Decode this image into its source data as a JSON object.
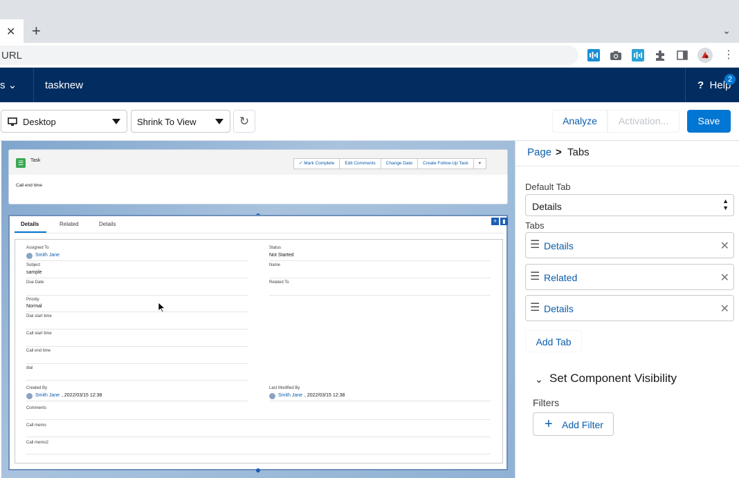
{
  "browser": {
    "tab_close": "✕",
    "new_tab": "+",
    "omnibox_placeholder": "URL",
    "extensions": [
      "audio-ext-icon",
      "camera-icon",
      "audio-ext-icon",
      "puzzle-icon",
      "sidepanel-icon",
      "profile-avatar",
      "kebab-menu-icon"
    ]
  },
  "header": {
    "app_name": "s",
    "page_name": "tasknew",
    "help_label": "Help",
    "help_count": "2"
  },
  "builder_toolbar": {
    "device_label": "Desktop",
    "view_label": "Shrink To View",
    "analyze_label": "Analyze",
    "activation_label": "Activation...",
    "save_label": "Save"
  },
  "canvas": {
    "record_title": "Task",
    "actions": [
      "Mark Complete",
      "Edit Comments",
      "Change Date",
      "Create Follow-Up Task"
    ],
    "highlight_field": "Call end time",
    "tabs": [
      "Details",
      "Related",
      "Details"
    ],
    "fields_left": [
      {
        "label": "Assigned To",
        "value": "Smith Jane",
        "link": true
      },
      {
        "label": "Subject",
        "value": "sample",
        "link": false
      },
      {
        "label": "Due Date",
        "value": "",
        "link": false
      },
      {
        "label": "Priority",
        "value": "Normal",
        "link": false
      },
      {
        "label": "Dial start time",
        "value": "",
        "link": false
      },
      {
        "label": "Call start time",
        "value": "",
        "link": false
      },
      {
        "label": "Call end time",
        "value": "",
        "link": false
      },
      {
        "label": "dial",
        "value": "",
        "link": false
      }
    ],
    "fields_right": [
      {
        "label": "Status",
        "value": "Not Started"
      },
      {
        "label": "Name",
        "value": ""
      },
      {
        "label": "Related To",
        "value": ""
      }
    ],
    "created_by_label": "Created By",
    "created_by_user": "Smith Jane",
    "created_by_date": ", 2022/03/15 12:38",
    "modified_by_label": "Last Modified By",
    "modified_by_user": "Smith Jane",
    "modified_by_date": ", 2022/03/15 12:38",
    "comments_label": "Comments",
    "call_memo_label": "Call memo",
    "call_memo2_label": "Call memo2"
  },
  "right_panel": {
    "breadcrumb_page": "Page",
    "breadcrumb_sep": ">",
    "breadcrumb_current": "Tabs",
    "default_tab_label": "Default Tab",
    "default_tab_value": "Details",
    "tabs_label": "Tabs",
    "tabs": [
      "Details",
      "Related",
      "Details"
    ],
    "add_tab_label": "Add Tab",
    "visibility_title": "Set Component Visibility",
    "filters_label": "Filters",
    "add_filter_label": "Add Filter"
  },
  "colors": {
    "header_bg": "#032d60",
    "brand_blue": "#0176d3",
    "link_blue": "#0b5cab"
  }
}
